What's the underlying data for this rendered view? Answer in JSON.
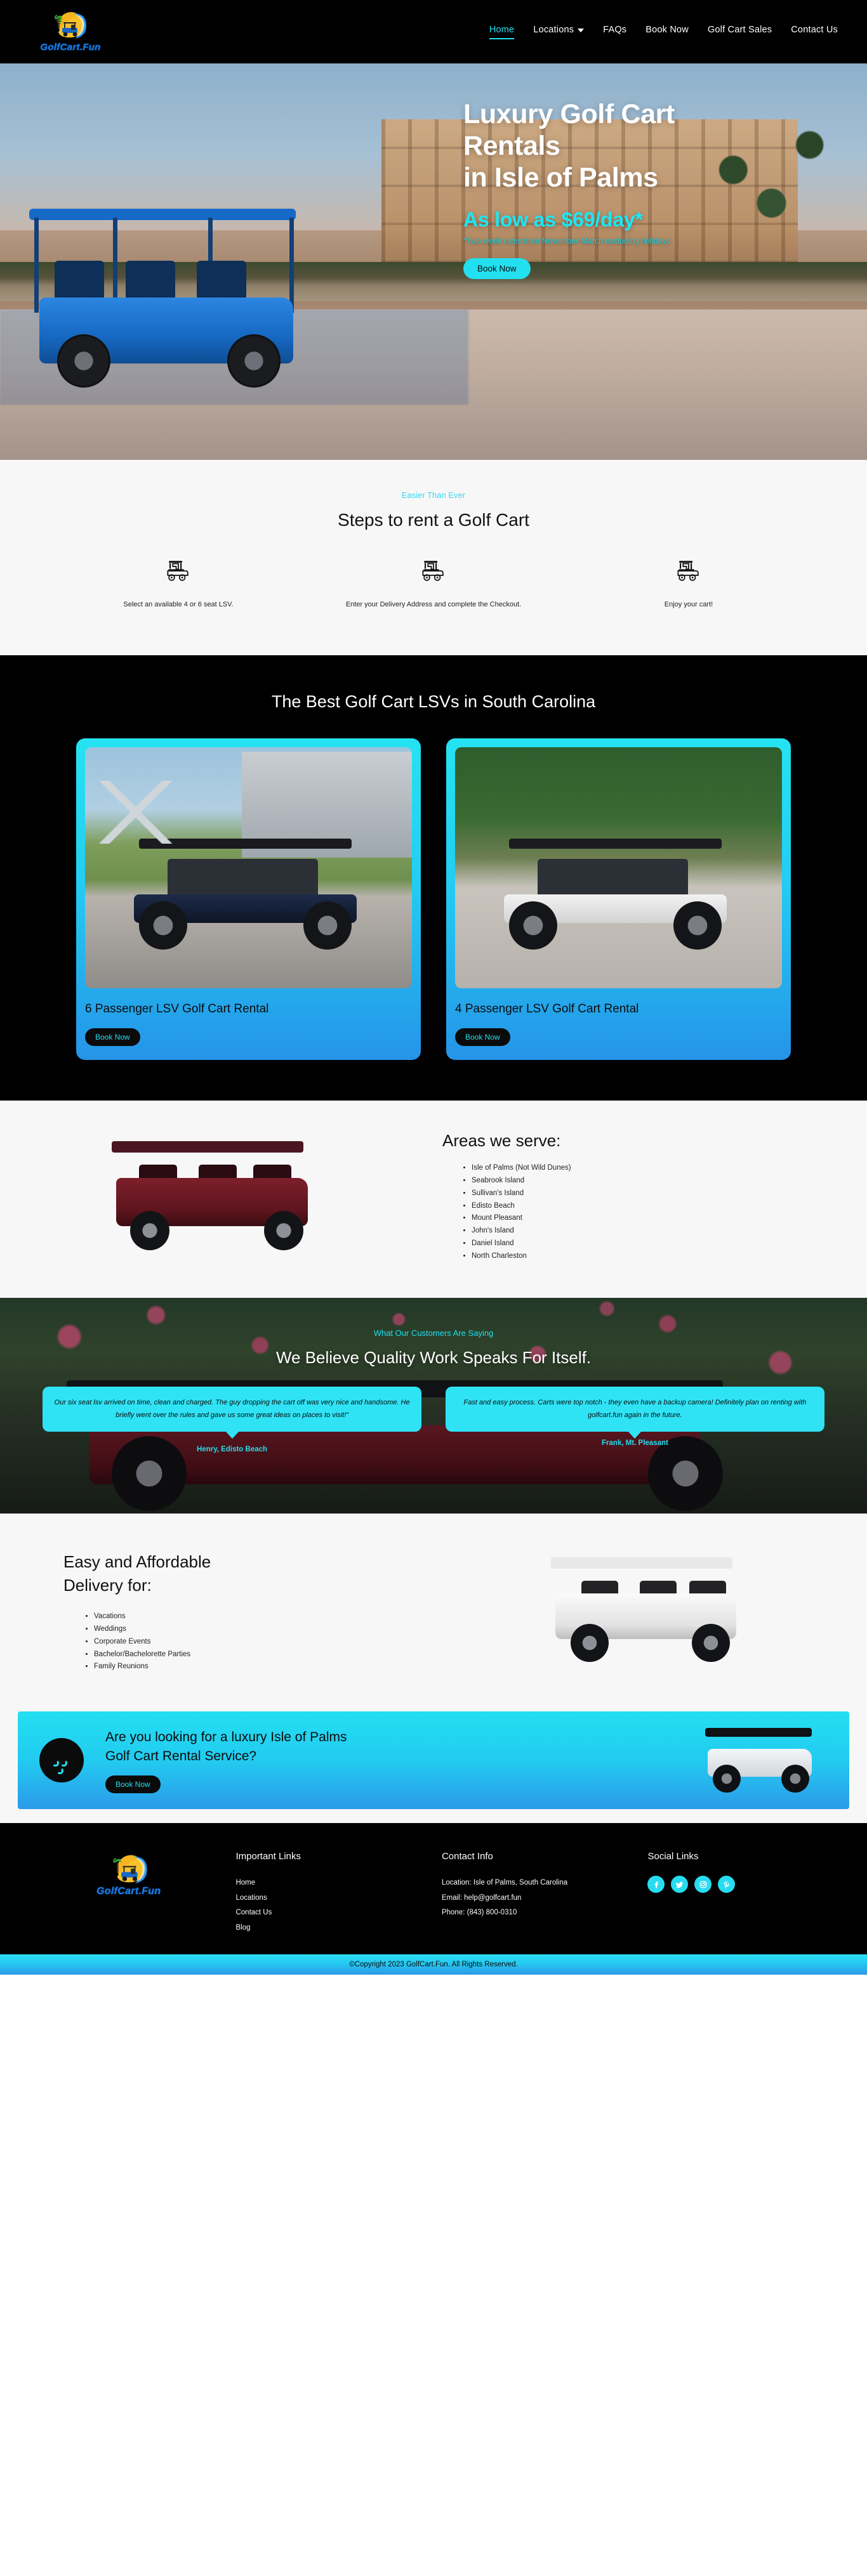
{
  "brand": {
    "word": "GolfCart.Fun",
    "logo_icon": "golf-cart-wave-logo"
  },
  "nav": {
    "items": [
      {
        "label": "Home",
        "active": true,
        "dropdown": false
      },
      {
        "label": "Locations",
        "active": false,
        "dropdown": true
      },
      {
        "label": "FAQs",
        "active": false,
        "dropdown": false
      },
      {
        "label": "Book Now",
        "active": false,
        "dropdown": false
      },
      {
        "label": "Golf Cart Sales",
        "active": false,
        "dropdown": false
      },
      {
        "label": "Contact Us",
        "active": false,
        "dropdown": false
      }
    ]
  },
  "hero": {
    "title_line1": "Luxury Golf Cart",
    "title_line2": "Rentals",
    "title_line3": "in Isle of Palms",
    "price": "As low as $69/day*",
    "note": "*Two week rates from November-March excluding holidays",
    "cta": "Book Now"
  },
  "steps": {
    "eyebrow": "Easier Than Ever",
    "title": "Steps to rent a Golf Cart",
    "items": [
      {
        "icon": "golf-cart-icon",
        "text": "Select an available 4 or 6 seat LSV."
      },
      {
        "icon": "golf-cart-icon",
        "text": "Enter your Delivery Address and complete the Checkout."
      },
      {
        "icon": "golf-cart-icon",
        "text": "Enjoy your cart!"
      }
    ]
  },
  "lsv": {
    "title": "The Best Golf Cart LSVs in South Carolina",
    "cards": [
      {
        "title": "6 Passenger LSV Golf Cart Rental",
        "cta": "Book Now",
        "photo": "navy-6-seat-cart-photo"
      },
      {
        "title": "4 Passenger LSV Golf Cart Rental",
        "cta": "Book Now",
        "photo": "white-4-seat-cart-photo"
      }
    ]
  },
  "areas": {
    "title": "Areas we serve:",
    "image": "red-golf-cart-photo",
    "items": [
      "Isle of Palms (Not Wild Dunes)",
      "Seabrook Island",
      "Sullivan's Island",
      "Edisto Beach",
      "Mount Pleasant",
      "John's Island",
      "Daniel Island",
      "North Charleston"
    ]
  },
  "testimonials": {
    "eyebrow": "What Our Customers Are Saying",
    "title": "We Believe Quality Work Speaks For Itself.",
    "items": [
      {
        "quote": "Our six seat lsv arrived on time, clean and charged. The guy dropping the cart off was very nice and handsome. He briefly went over the rules and gave us some great ideas on places to visit!”",
        "name": "Henry, Edisto Beach"
      },
      {
        "quote": "Fast and easy process. Carts were top notch - they even have a backup camera! Definitely plan on renting with golfcart.fun again in the future.",
        "name": "Frank, Mt. Pleasant"
      }
    ]
  },
  "delivery": {
    "title_line1": "Easy and Affordable",
    "title_line2": "Delivery for:",
    "image": "white-golf-cart-photo",
    "items": [
      "Vacations",
      "Weddings",
      "Corporate Events",
      "Bachelor/Bachelorette Parties",
      "Family Reunions"
    ]
  },
  "cta_banner": {
    "icon": "golf-ball-icon",
    "title_line1": "Are you looking for a luxury Isle of Palms",
    "title_line2": "Golf Cart Rental Service?",
    "button": "Book Now",
    "image": "blue-white-golf-cart-photo"
  },
  "footer": {
    "brand_word": "GolfCart.Fun",
    "links": {
      "heading": "Important Links",
      "items": [
        "Home",
        "Locations",
        "Contact Us",
        "Blog"
      ]
    },
    "contact": {
      "heading": "Contact Info",
      "location": "Location: Isle of Palms, South Carolina",
      "email": "Email: help@golfcart.fun",
      "phone": "Phone: (843) 800-0310"
    },
    "social": {
      "heading": "Social Links",
      "items": [
        {
          "name": "facebook-icon",
          "glyph": "f"
        },
        {
          "name": "twitter-icon",
          "glyph": "❧"
        },
        {
          "name": "instagram-icon",
          "glyph": "▣"
        },
        {
          "name": "pinterest-icon",
          "glyph": "ⓟ"
        }
      ]
    },
    "copyright": "©Copyright 2023 GolfCart.Fun. All Rights Reserved."
  },
  "colors": {
    "accent": "#22e0f0",
    "dark": "#000000",
    "light": "#f7f7f7",
    "brand_blue": "#1b7fe8"
  }
}
